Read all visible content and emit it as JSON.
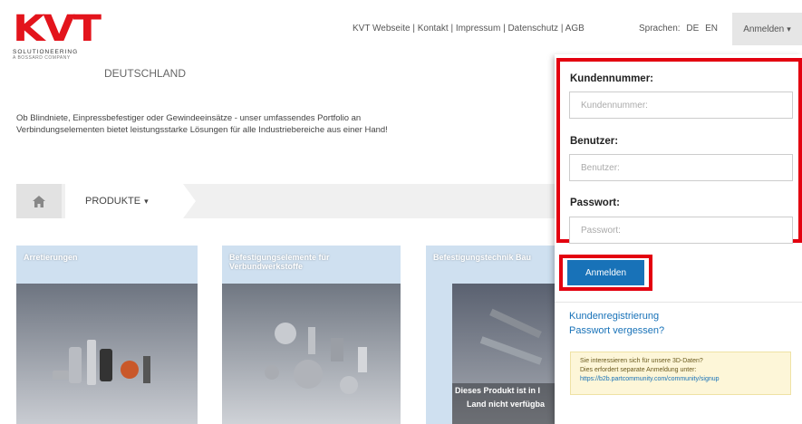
{
  "logo": {
    "mark": "KVT",
    "line1": "SOLUTIONEERING",
    "line2": "A BOSSARD COMPANY",
    "country": "DEUTSCHLAND"
  },
  "topnav": {
    "links": [
      "KVT Webseite",
      "Kontakt",
      "Impressum",
      "Datenschutz",
      "AGB"
    ],
    "separator": "|",
    "languages_label": "Sprachen:",
    "languages": [
      "DE",
      "EN"
    ],
    "login_label": "Anmelden",
    "caret": "▾"
  },
  "intro": {
    "line1": "Ob Blindniete, Einpressbefestiger oder Gewindeeinsätze - unser umfassendes Portfolio an",
    "line2": "Verbindungselementen bietet leistungsstarke Lösungen für alle Industriebereiche aus einer Hand!"
  },
  "breadcrumb": {
    "home_icon": "home-icon",
    "products": "PRODUKTE",
    "caret": "▾"
  },
  "cards": [
    {
      "title": "Arretierungen"
    },
    {
      "title": "Befestigungselemente für Verbundwerkstoffe"
    },
    {
      "title": "Befestigungstechnik Bau",
      "note_line1": "Dieses Produkt ist in I",
      "note_line2": "Land nicht verfügba"
    }
  ],
  "login_form": {
    "customer_label": "Kundennummer:",
    "customer_placeholder": "Kundennummer:",
    "user_label": "Benutzer:",
    "user_placeholder": "Benutzer:",
    "password_label": "Passwort:",
    "password_placeholder": "Passwort:",
    "submit_label": "Anmelden"
  },
  "panel_links": {
    "register": "Kundenregistrierung",
    "forgot": "Passwort vergessen?"
  },
  "info": {
    "line1": "Sie interessieren sich für unsere 3D-Daten?",
    "line2": "Dies erfordert separate Anmeldung unter:",
    "url": "https://b2b.partcommunity.com/community/signup"
  },
  "colors": {
    "brand_red": "#e3141c",
    "highlight_red": "#e3000f",
    "button_blue": "#1872b8",
    "card_blue": "#cfe0f0"
  }
}
